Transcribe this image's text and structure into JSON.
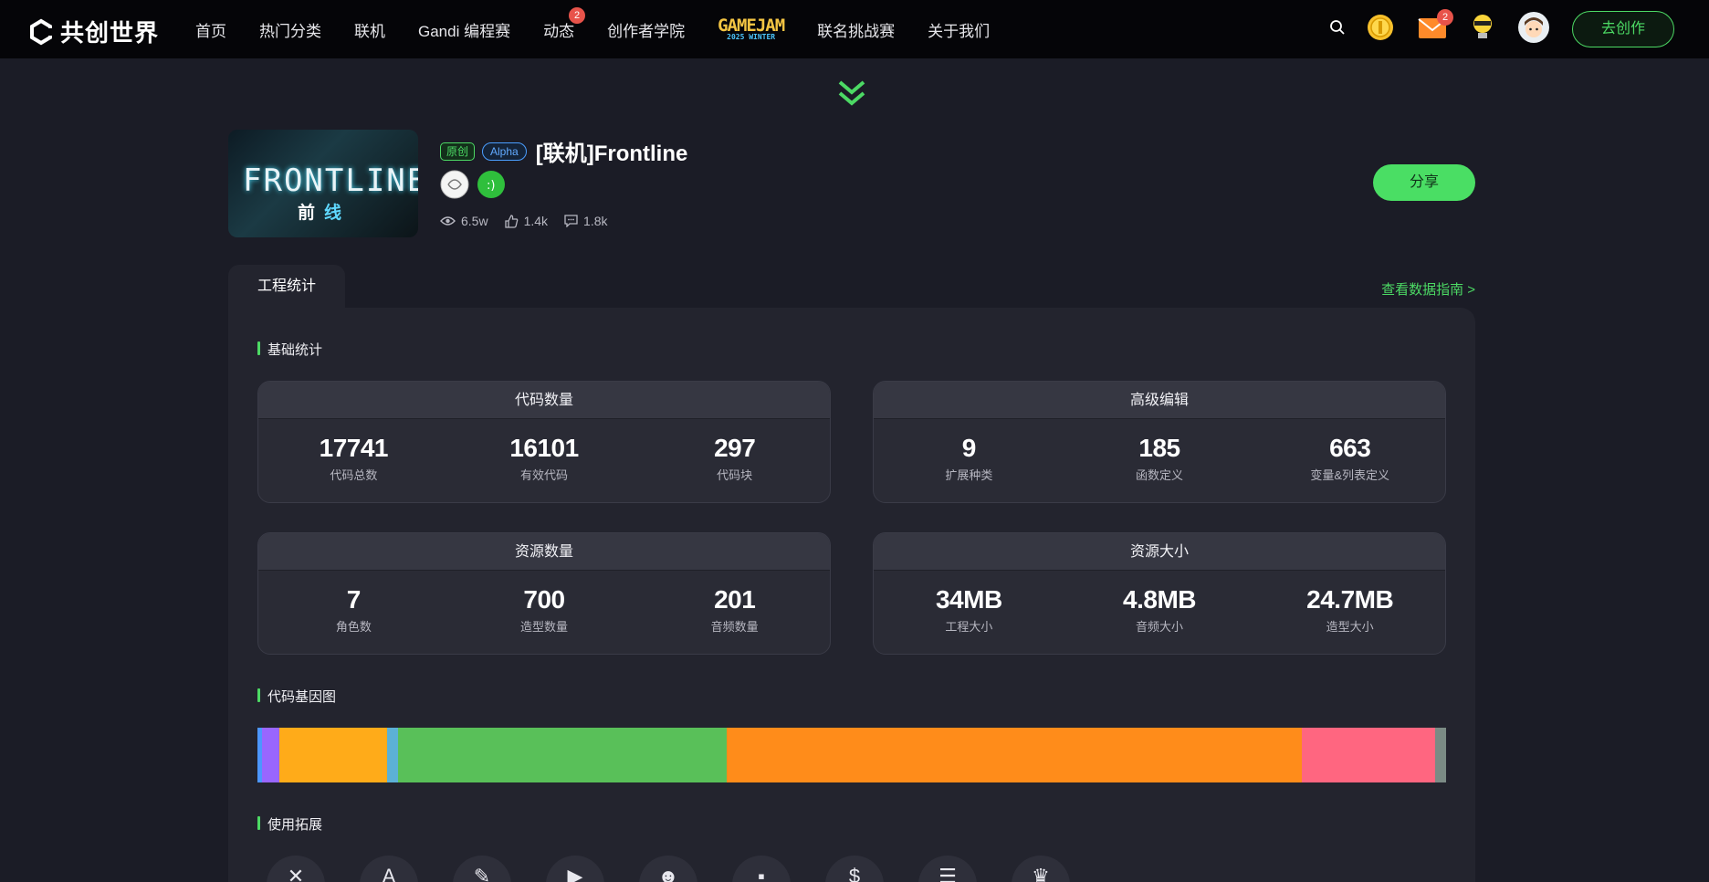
{
  "nav": {
    "logo_text": "共创世界",
    "items": [
      {
        "label": "首页"
      },
      {
        "label": "热门分类"
      },
      {
        "label": "联机"
      },
      {
        "label": "Gandi 编程赛"
      },
      {
        "label": "动态",
        "badge": "2"
      },
      {
        "label": "创作者学院"
      }
    ],
    "gamejam": {
      "title": "GAMEJAM",
      "subtitle": "2025 WINTER"
    },
    "items_after": [
      {
        "label": "联名挑战赛"
      },
      {
        "label": "关于我们"
      }
    ],
    "mail_badge": "2",
    "create_label": "去创作"
  },
  "project": {
    "cover_title": "FRONTLINE",
    "cover_sub_1": "前",
    "cover_sub_2": "线",
    "tag_original": "原创",
    "tag_alpha": "Alpha",
    "title": "[联机]Frontline",
    "views": "6.5w",
    "likes": "1.4k",
    "comments": "1.8k",
    "share_label": "分享"
  },
  "tabs": {
    "active": "工程统计",
    "guide_link": "查看数据指南 >"
  },
  "sections": {
    "basic": "基础统计",
    "gene": "代码基因图",
    "extensions": "使用拓展"
  },
  "cards": [
    {
      "title": "代码数量",
      "metrics": [
        {
          "value": "17741",
          "label": "代码总数"
        },
        {
          "value": "16101",
          "label": "有效代码"
        },
        {
          "value": "297",
          "label": "代码块"
        }
      ]
    },
    {
      "title": "高级编辑",
      "metrics": [
        {
          "value": "9",
          "label": "扩展种类"
        },
        {
          "value": "185",
          "label": "函数定义"
        },
        {
          "value": "663",
          "label": "变量&列表定义"
        }
      ]
    },
    {
      "title": "资源数量",
      "metrics": [
        {
          "value": "7",
          "label": "角色数"
        },
        {
          "value": "700",
          "label": "造型数量"
        },
        {
          "value": "201",
          "label": "音频数量"
        }
      ]
    },
    {
      "title": "资源大小",
      "metrics": [
        {
          "value": "34MB",
          "label": "工程大小"
        },
        {
          "value": "4.8MB",
          "label": "音频大小"
        },
        {
          "value": "24.7MB",
          "label": "造型大小"
        }
      ]
    }
  ],
  "gene_segments": [
    {
      "color": "#4c97ff",
      "share": 0.4
    },
    {
      "color": "#9966ff",
      "share": 1.4
    },
    {
      "color": "#ffab19",
      "share": 9.1
    },
    {
      "color": "#5cb1d6",
      "share": 0.9
    },
    {
      "color": "#59c059",
      "share": 27.5
    },
    {
      "color": "#ff8c1a",
      "share": 48.2
    },
    {
      "color": "#ff6680",
      "share": 11.2
    },
    {
      "color": "#7b8b85",
      "share": 0.9
    }
  ],
  "extensions": [
    {
      "icon": "circle-x-icon",
      "glyph": "✕"
    },
    {
      "icon": "letter-a-icon",
      "glyph": "A"
    },
    {
      "icon": "pen-icon",
      "glyph": "✎"
    },
    {
      "icon": "play-icon",
      "glyph": "▶"
    },
    {
      "icon": "face-icon",
      "glyph": "☻"
    },
    {
      "icon": "pixel-icon",
      "glyph": "▪"
    },
    {
      "icon": "dollar-icon",
      "glyph": "$"
    },
    {
      "icon": "list-icon",
      "glyph": "☰"
    },
    {
      "icon": "trophy-icon",
      "glyph": "♛"
    }
  ]
}
